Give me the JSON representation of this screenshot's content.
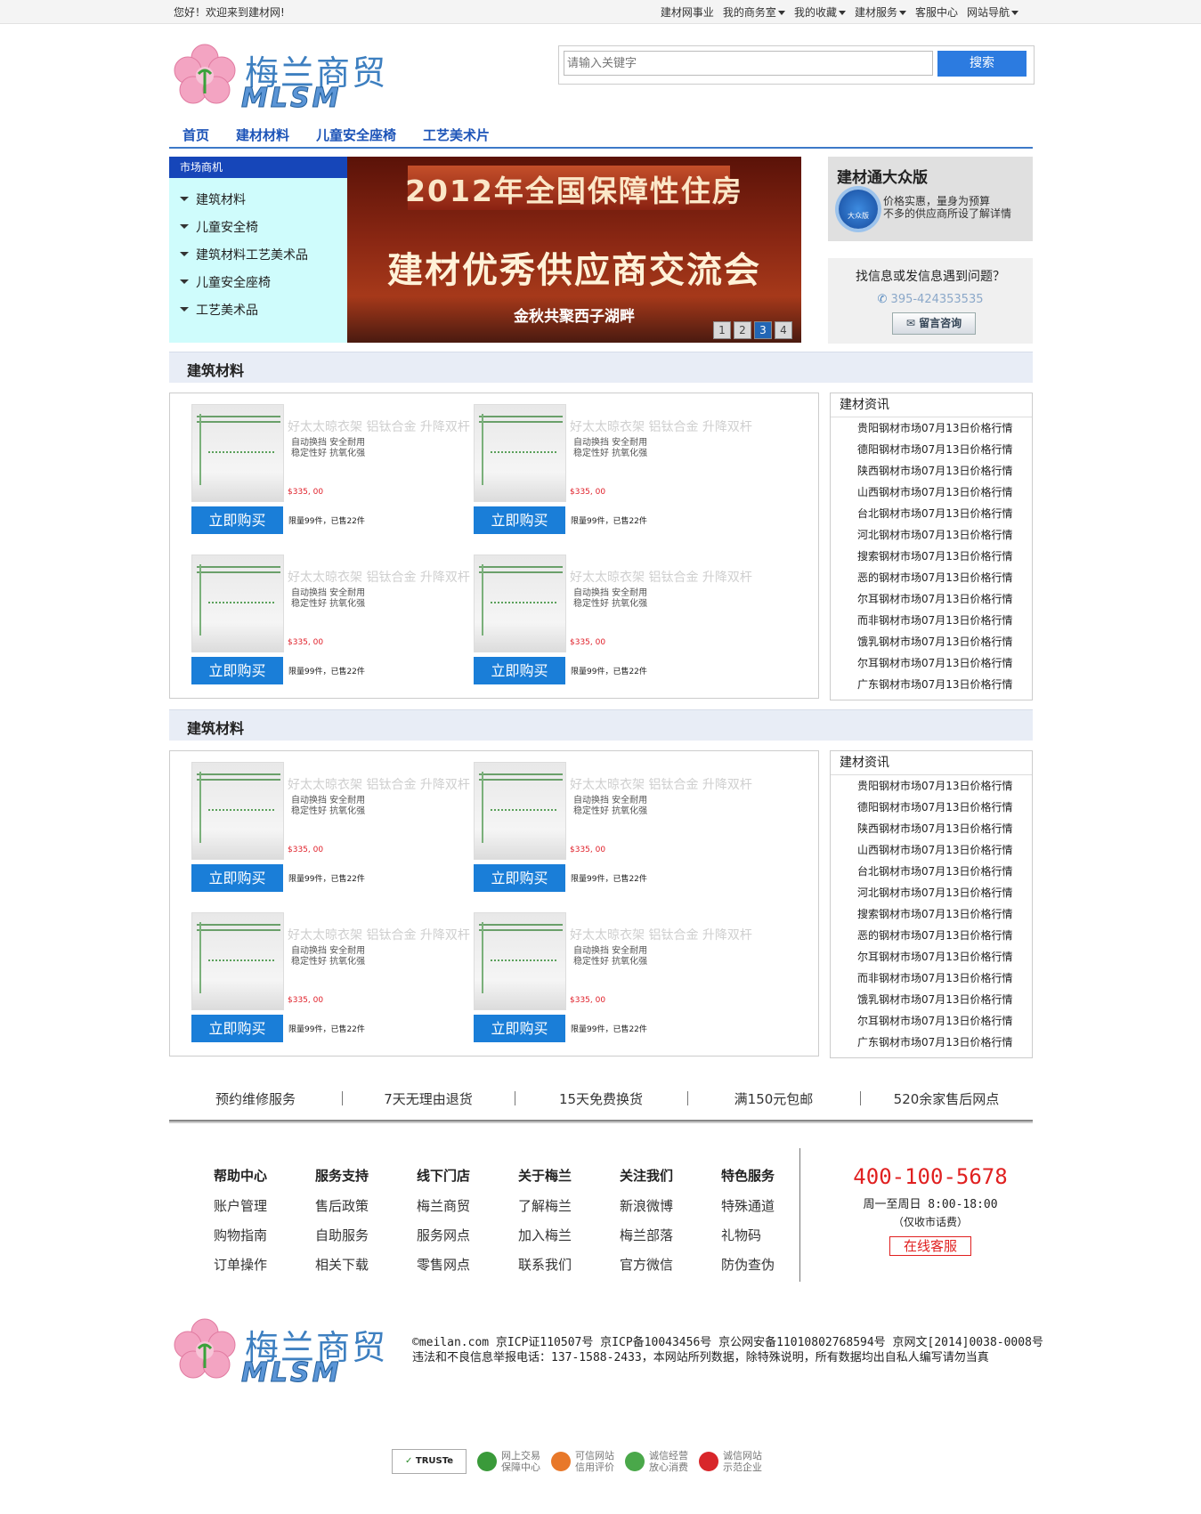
{
  "topbar": {
    "welcome": "您好！欢迎来到建材网!",
    "links": [
      "建材网事业",
      "我的商务室",
      "我的收藏",
      "建材服务",
      "客服中心",
      "网站导航"
    ]
  },
  "header": {
    "logo_text": "梅兰商贸",
    "logo_sub": "MLSM",
    "search_placeholder": "请输入关键字",
    "search_button": "搜索"
  },
  "nav": [
    "首页",
    "建材材料",
    "儿童安全座椅",
    "工艺美术片"
  ],
  "market": {
    "title": "市场商机",
    "items": [
      "建筑材料",
      "儿童安全椅",
      "建筑材料工艺美术品",
      "儿童安全座椅",
      "工艺美术品"
    ]
  },
  "banner": {
    "line1": "2012年全国保障性住房",
    "line2": "建材优秀供应商交流会",
    "line3": "金秋共聚西子湖畔",
    "pages": [
      "1",
      "2",
      "3",
      "4"
    ],
    "active_page": 3
  },
  "promo": {
    "title": "建材通大众版",
    "badge": "大众版",
    "desc_line1": "价格实惠，量身为预算",
    "desc_line2": "不多的供应商所设了解详情"
  },
  "help": {
    "question": "找信息或发信息遇到问题？",
    "phone": "395-424353535",
    "button": "留言咨询"
  },
  "sections": [
    {
      "title": "建筑材料",
      "products": [
        {
          "name": "好太太晾衣架 铝钛合金 升降双杆",
          "feat1": "自动换挡 安全耐用",
          "feat2": "稳定性好 抗氧化强",
          "price": "$335, 00",
          "buy": "立即购买",
          "sold": "限量99件，已售22件"
        },
        {
          "name": "好太太晾衣架 铝钛合金 升降双杆",
          "feat1": "自动换挡 安全耐用",
          "feat2": "稳定性好 抗氧化强",
          "price": "$335, 00",
          "buy": "立即购买",
          "sold": "限量99件，已售22件"
        },
        {
          "name": "好太太晾衣架 铝钛合金 升降双杆",
          "feat1": "自动换挡 安全耐用",
          "feat2": "稳定性好 抗氧化强",
          "price": "$335, 00",
          "buy": "立即购买",
          "sold": "限量99件，已售22件"
        },
        {
          "name": "好太太晾衣架 铝钛合金 升降双杆",
          "feat1": "自动换挡 安全耐用",
          "feat2": "稳定性好 抗氧化强",
          "price": "$335, 00",
          "buy": "立即购买",
          "sold": "限量99件，已售22件"
        }
      ],
      "news_title": "建材资讯",
      "news": [
        "贵阳钢材市场07月13日价格行情",
        "德阳钢材市场07月13日价格行情",
        "陕西钢材市场07月13日价格行情",
        "山西钢材市场07月13日价格行情",
        "台北钢材市场07月13日价格行情",
        "河北钢材市场07月13日价格行情",
        "搜索钢材市场07月13日价格行情",
        "恶的钢材市场07月13日价格行情",
        "尔耳钢材市场07月13日价格行情",
        "而非钢材市场07月13日价格行情",
        "饿乳钢材市场07月13日价格行情",
        "尔耳钢材市场07月13日价格行情",
        "广东钢材市场07月13日价格行情"
      ]
    },
    {
      "title": "建筑材料",
      "products": [
        {
          "name": "好太太晾衣架 铝钛合金 升降双杆",
          "feat1": "自动换挡 安全耐用",
          "feat2": "稳定性好 抗氧化强",
          "price": "$335, 00",
          "buy": "立即购买",
          "sold": "限量99件，已售22件"
        },
        {
          "name": "好太太晾衣架 铝钛合金 升降双杆",
          "feat1": "自动换挡 安全耐用",
          "feat2": "稳定性好 抗氧化强",
          "price": "$335, 00",
          "buy": "立即购买",
          "sold": "限量99件，已售22件"
        },
        {
          "name": "好太太晾衣架 铝钛合金 升降双杆",
          "feat1": "自动换挡 安全耐用",
          "feat2": "稳定性好 抗氧化强",
          "price": "$335, 00",
          "buy": "立即购买",
          "sold": "限量99件，已售22件"
        },
        {
          "name": "好太太晾衣架 铝钛合金 升降双杆",
          "feat1": "自动换挡 安全耐用",
          "feat2": "稳定性好 抗氧化强",
          "price": "$335, 00",
          "buy": "立即购买",
          "sold": "限量99件，已售22件"
        }
      ],
      "news_title": "建材资讯",
      "news": [
        "贵阳钢材市场07月13日价格行情",
        "德阳钢材市场07月13日价格行情",
        "陕西钢材市场07月13日价格行情",
        "山西钢材市场07月13日价格行情",
        "台北钢材市场07月13日价格行情",
        "河北钢材市场07月13日价格行情",
        "搜索钢材市场07月13日价格行情",
        "恶的钢材市场07月13日价格行情",
        "尔耳钢材市场07月13日价格行情",
        "而非钢材市场07月13日价格行情",
        "饿乳钢材市场07月13日价格行情",
        "尔耳钢材市场07月13日价格行情",
        "广东钢材市场07月13日价格行情"
      ]
    }
  ],
  "services": [
    "预约维修服务",
    "7天无理由退货",
    "15天免费换货",
    "满150元包邮",
    "520余家售后网点"
  ],
  "footer_cols": [
    {
      "title": "帮助中心",
      "links": [
        "账户管理",
        "购物指南",
        "订单操作"
      ]
    },
    {
      "title": "服务支持",
      "links": [
        "售后政策",
        "自助服务",
        "相关下载"
      ]
    },
    {
      "title": "线下门店",
      "links": [
        "梅兰商贸",
        "服务网点",
        "零售网点"
      ]
    },
    {
      "title": "关于梅兰",
      "links": [
        "了解梅兰",
        "加入梅兰",
        "联系我们"
      ]
    },
    {
      "title": "关注我们",
      "links": [
        "新浪微博",
        "梅兰部落",
        "官方微信"
      ]
    },
    {
      "title": "特色服务",
      "links": [
        "特殊通道",
        "礼物码",
        "防伪查伪"
      ]
    }
  ],
  "hotline": {
    "number": "400-100-5678",
    "hours": "周一至周日 8:00-18:00",
    "note": "（仅收市话费）",
    "online": "在线客服"
  },
  "legal": {
    "line1": "©meilan.com 京ICP证110507号 京ICP备10043456号 京公网安备11010802768594号 京网文[2014]0038-0008号",
    "line2": "违法和不良信息举报电话：137-1588-2433，本网站所列数据，除特殊说明，所有数据均出自私人编写请勿当真"
  },
  "trust": {
    "truste": "TRUSTe",
    "badges": [
      {
        "l1": "网上交易",
        "l2": "保障中心",
        "color": "#3a9a3a"
      },
      {
        "l1": "可信网站",
        "l2": "信用评价",
        "color": "#e8782a"
      },
      {
        "l1": "诚信经营",
        "l2": "放心消费",
        "color": "#4aa84a"
      },
      {
        "l1": "诚信网站",
        "l2": "示范企业",
        "color": "#d8262a"
      }
    ]
  }
}
